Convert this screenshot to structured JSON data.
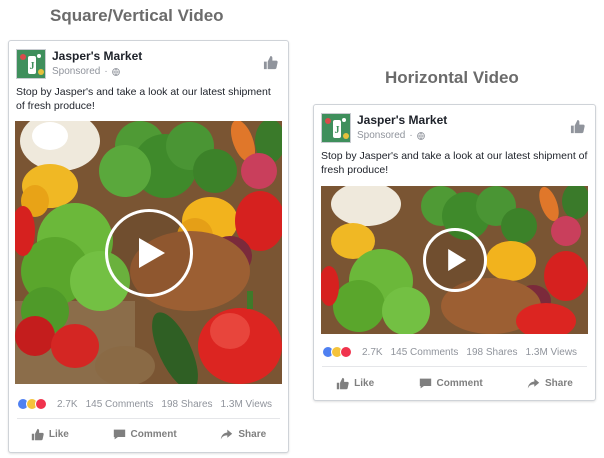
{
  "headings": {
    "left": "Square/Vertical Video",
    "right": "Horizontal Video"
  },
  "post": {
    "page_name": "Jasper's Market",
    "sponsored": "Sponsored",
    "text_square": "Stop by Jasper's and take a look at our latest shipment of fresh produce!",
    "text_horizontal": "Stop by Jasper's and take a look at our latest shipment of fresh produce!",
    "reaction_count": "2.7K",
    "comments": "145 Comments",
    "shares": "198 Shares",
    "views": "1.3M Views",
    "actions": {
      "like": "Like",
      "comment": "Comment",
      "share": "Share"
    }
  },
  "colors": {
    "heading": "#6b6b6b",
    "brand_blue": "#4f80f1",
    "muted": "#90949c"
  },
  "icons": [
    "globe-icon",
    "like-thumb-icon",
    "play-icon",
    "like-action-icon",
    "comment-action-icon",
    "share-action-icon"
  ]
}
